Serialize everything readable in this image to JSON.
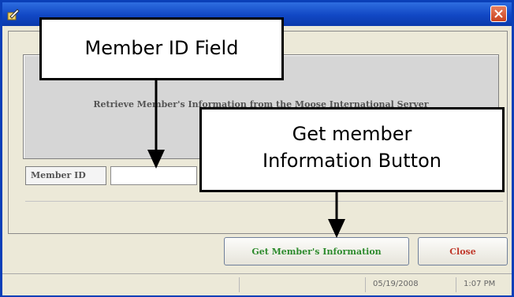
{
  "window": {
    "title_icon": "app-icon",
    "close_icon": "close-icon"
  },
  "group": {
    "text": "Retrieve Member's Information from the Moose International Server"
  },
  "form": {
    "member_id_label": "Member ID",
    "member_id_value": ""
  },
  "buttons": {
    "get_info_label": "Get Member's Information",
    "close_label": "Close"
  },
  "statusbar": {
    "date": "05/19/2008",
    "time": "1:07 PM"
  },
  "annotations": {
    "member_id_callout": "Member ID Field",
    "get_info_callout_line1": "Get member",
    "get_info_callout_line2": "Information Button"
  }
}
